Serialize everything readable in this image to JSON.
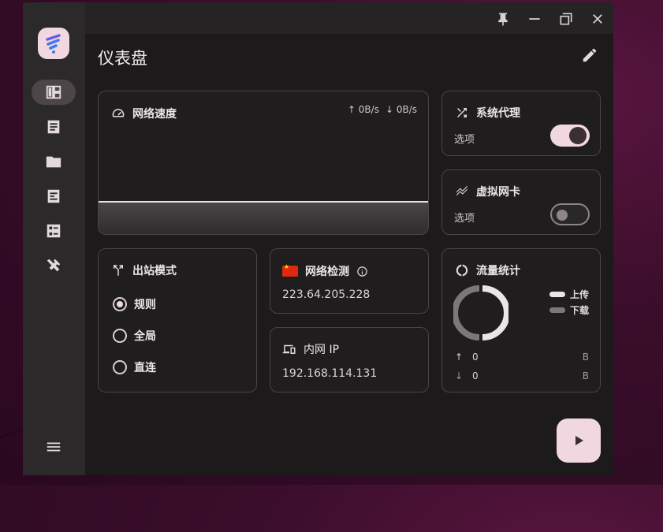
{
  "app": {
    "page_title": "仪表盘"
  },
  "titlebar": {
    "buttons": [
      "pin-icon",
      "minimize-icon",
      "maximize-icon",
      "close-icon"
    ]
  },
  "sidebar": {
    "items": [
      {
        "icon": "dashboard-icon",
        "active": true
      },
      {
        "icon": "article-icon",
        "active": false
      },
      {
        "icon": "folder-icon",
        "active": false
      },
      {
        "icon": "logs-icon",
        "active": false
      },
      {
        "icon": "checklist-icon",
        "active": false
      },
      {
        "icon": "tools-icon",
        "active": false
      }
    ],
    "menu_icon": "menu-icon"
  },
  "network_speed": {
    "title": "网络速度",
    "upload": "0B/s",
    "download": "0B/s"
  },
  "system_proxy": {
    "title": "系统代理",
    "subtitle": "选项",
    "enabled": true
  },
  "tun": {
    "title": "虚拟网卡",
    "subtitle": "选项",
    "enabled": false
  },
  "outbound_mode": {
    "title": "出站模式",
    "options": [
      {
        "label": "规则",
        "selected": true
      },
      {
        "label": "全局",
        "selected": false
      },
      {
        "label": "直连",
        "selected": false
      }
    ]
  },
  "network_check": {
    "title": "网络检测",
    "ip": "223.64.205.228"
  },
  "intranet_ip": {
    "title": "内网 IP",
    "ip": "192.168.114.131"
  },
  "traffic": {
    "title": "流量统计",
    "legend": {
      "upload": "上传",
      "download": "下载"
    },
    "upload_value": "0",
    "download_value": "0",
    "upload_unit": "B",
    "download_unit": "B"
  },
  "colors": {
    "accent": "#f0d7e0",
    "background": "#1c1a1b",
    "border": "#4a4446",
    "muted": "#8d8589"
  }
}
